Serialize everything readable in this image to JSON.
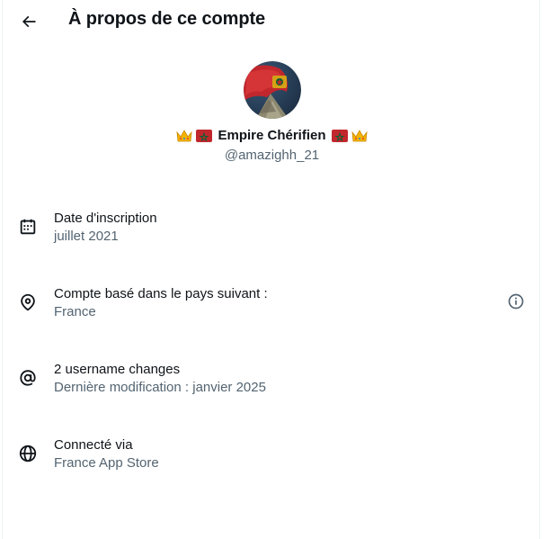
{
  "header": {
    "back_icon": "arrow-left-icon",
    "title": "À propos de ce compte"
  },
  "profile": {
    "display_name": "Empire Chérifien",
    "handle": "@amazighh_21",
    "name_emojis": [
      "crown",
      "morocco-flag",
      "morocco-flag",
      "crown"
    ],
    "colors": {
      "flag_red": "#c1272d",
      "flag_green": "#006233",
      "crown_gold": "#f4b400"
    }
  },
  "details": [
    {
      "icon": "calendar-icon",
      "title": "Date d'inscription",
      "subtitle": "juillet 2021"
    },
    {
      "icon": "location-pin-icon",
      "title": "Compte basé dans le pays suivant :",
      "subtitle": "France",
      "trailing_icon": "info-icon"
    },
    {
      "icon": "at-sign-icon",
      "title": "2 username changes",
      "subtitle": "Dernière modification : janvier 2025"
    },
    {
      "icon": "globe-icon",
      "title": "Connecté via",
      "subtitle": "France App Store"
    }
  ],
  "colors": {
    "primary_text": "#0f1419",
    "secondary_text": "#536471",
    "border": "#eff3f4"
  }
}
